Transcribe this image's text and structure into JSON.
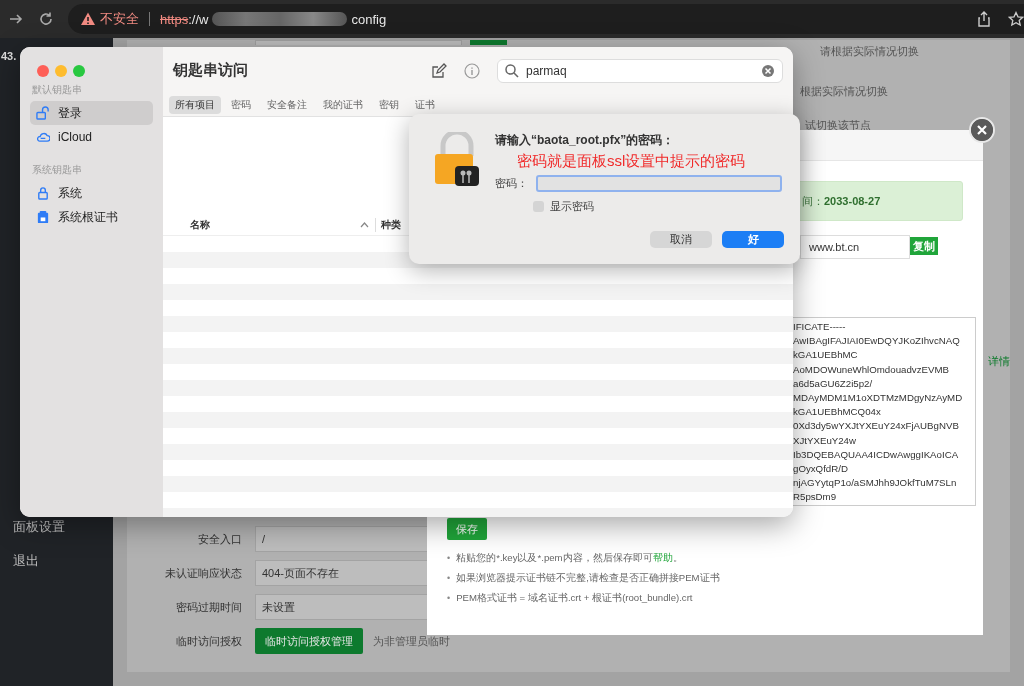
{
  "browser": {
    "security_label": "不安全",
    "url_scheme": "https",
    "url_host": "://w",
    "url_path": "config"
  },
  "background_page": {
    "host_label": "43.",
    "nav": [
      {
        "label": "面板设置"
      },
      {
        "label": "退出"
      }
    ],
    "hints": [
      "请根据实际情况切换",
      "根据实际情况切换",
      "试切换该节点"
    ],
    "detail_link": "详情",
    "form": [
      {
        "kind": "field",
        "label": "安全入口",
        "value": "/"
      },
      {
        "kind": "field",
        "label": "未认证响应状态",
        "value": "404-页面不存在"
      },
      {
        "kind": "field",
        "label": "密码过期时间",
        "value": "未设置"
      },
      {
        "kind": "button",
        "label": "临时访问授权",
        "button": "临时访问授权管理",
        "note": "为非管理员临时"
      }
    ]
  },
  "ssl_modal": {
    "alert_label": "间：",
    "alert_value": "2033-08-27",
    "domain": "www.bt.cn",
    "copy_button": "复制",
    "cert_lines": [
      "IFICATE-----",
      "AwIBAgIFAJIAI0EwDQYJKoZIhvcNAQ",
      "kGA1UEBhMC",
      "AoMDOWuneWhlOmdouadvzEVMB",
      "a6d5aGU6Z2i5p2/",
      "MDAyMDM1M1oXDTMzMDgyNzAyMD",
      "kGA1UEBhMCQ04x",
      "0Xd3dy5wYXJtYXEuY24xFjAUBgNVB",
      "XJtYXEuY24w",
      "Ib3DQEBAQUAA4ICDwAwggIKAoICA",
      "gOyxQfdR/D",
      "njAGYytqP1o/aSMJhh9JOkfTuM7SLn",
      "R5psDm9"
    ],
    "save_button": "保存",
    "tip_bullet": "•",
    "tips": [
      {
        "text": "粘贴您的*.key以及*.pem内容，然后保存即可",
        "link": "帮助",
        "tail": "。"
      },
      {
        "text": "如果浏览器提示证书链不完整,请检查是否正确拼接PEM证书"
      },
      {
        "text": "PEM格式证书 = 域名证书.crt + 根证书(root_bundle).crt"
      }
    ]
  },
  "keychain": {
    "title": "钥匙串访问",
    "search": "parmaq",
    "sidebar": [
      {
        "kind": "heading",
        "label": "默认钥匙串"
      },
      {
        "kind": "item",
        "label": "登录",
        "selected": true
      },
      {
        "kind": "item",
        "label": "iCloud",
        "selected": false
      },
      {
        "kind": "heading",
        "label": "系统钥匙串"
      },
      {
        "kind": "item",
        "label": "系统",
        "selected": false
      },
      {
        "kind": "item",
        "label": "系统根证书",
        "selected": false
      }
    ],
    "tabs": [
      {
        "label": "所有项目",
        "selected": true
      },
      {
        "label": "密码",
        "selected": false
      },
      {
        "label": "安全备注",
        "selected": false
      },
      {
        "label": "我的证书",
        "selected": false
      },
      {
        "label": "密钥",
        "selected": false
      },
      {
        "label": "证书",
        "selected": false
      }
    ],
    "columns": [
      "名称",
      "种类"
    ]
  },
  "dialog": {
    "title": "请输入“baota_root.pfx”的密码：",
    "annotation": "密码就是面板ssl设置中提示的密码",
    "password_label": "密码：",
    "show_password": {
      "label": "显示密码",
      "checked": false
    },
    "buttons": [
      {
        "kind": "secondary",
        "label": "取消"
      },
      {
        "kind": "primary",
        "label": "好"
      }
    ]
  }
}
